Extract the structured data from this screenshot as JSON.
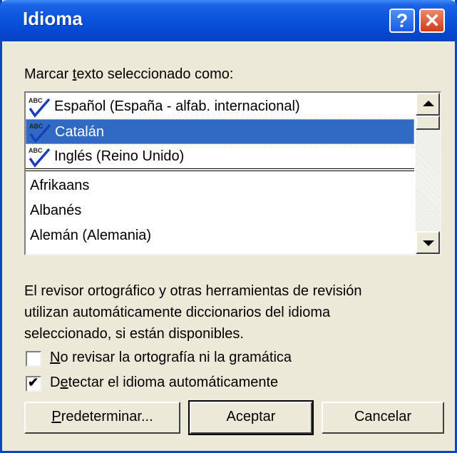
{
  "window": {
    "title": "Idioma",
    "help_button": "?",
    "close_button": "✕"
  },
  "prompt": {
    "pre": "Marcar ",
    "accel": "t",
    "post": "exto seleccionado como:"
  },
  "languages": {
    "recent": [
      {
        "label": "Español (España - alfab. internacional)",
        "icon": "spellcheck-abc-icon",
        "selected": false
      },
      {
        "label": "Catalán",
        "icon": "spellcheck-abc-icon",
        "selected": true
      },
      {
        "label": "Inglés (Reino Unido)",
        "icon": "spellcheck-abc-icon",
        "selected": false
      }
    ],
    "others": [
      "Afrikaans",
      "Albanés",
      "Alemán (Alemania)"
    ]
  },
  "info": {
    "line1": "El revisor ortográfico y otras herramientas de revisión",
    "line2": "utilizan automáticamente diccionarios del idioma",
    "line3": "seleccionado, si están disponibles."
  },
  "options": {
    "no_check": {
      "accel": "N",
      "rest": "o revisar la ortografía ni la gramática",
      "checked": false
    },
    "detect": {
      "pre": "D",
      "accel": "e",
      "rest": "tectar el idioma automáticamente",
      "checked": true,
      "mark": "✔"
    }
  },
  "buttons": {
    "default": {
      "accel": "P",
      "rest": "redeterminar..."
    },
    "ok": "Aceptar",
    "cancel": "Cancelar"
  },
  "colors": {
    "titlebar": "#0a55dc",
    "selection": "#316ac5",
    "dialog_bg": "#ece9d8"
  }
}
